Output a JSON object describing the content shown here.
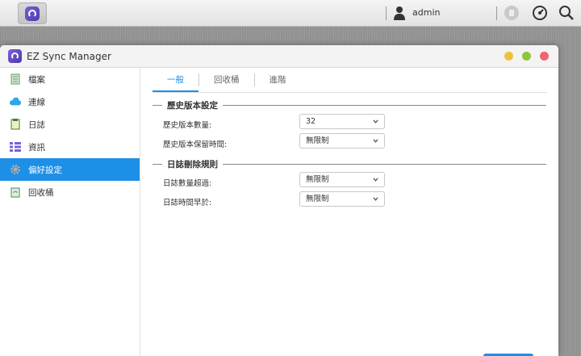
{
  "taskbar": {
    "user_name": "admin"
  },
  "window": {
    "title": "EZ Sync Manager",
    "controls": {
      "minimize_color": "#f0c23b",
      "maximize_color": "#8cc63f",
      "close_color": "#f0646e"
    }
  },
  "sidebar": {
    "items": [
      {
        "label": "檔案",
        "icon": "files-icon"
      },
      {
        "label": "連線",
        "icon": "cloud-sync-icon"
      },
      {
        "label": "日誌",
        "icon": "log-icon"
      },
      {
        "label": "資訊",
        "icon": "info-list-icon"
      },
      {
        "label": "偏好設定",
        "icon": "gear-icon",
        "active": true
      },
      {
        "label": "回收桶",
        "icon": "recycle-bin-icon"
      }
    ]
  },
  "tabs": [
    {
      "label": "一般",
      "active": true
    },
    {
      "label": "回收桶"
    },
    {
      "label": "進階"
    }
  ],
  "history_section": {
    "title": "歷史版本設定",
    "version_count_label": "歷史版本數量:",
    "version_count_value": "32",
    "retention_label": "歷史版本保留時間:",
    "retention_value": "無限制"
  },
  "log_section": {
    "title": "日誌刪除規則",
    "count_exceeds_label": "日誌數量超過:",
    "count_exceeds_value": "無限制",
    "older_than_label": "日誌時間早於:",
    "older_than_value": "無限制"
  },
  "colors": {
    "accent": "#1e8fe6"
  }
}
